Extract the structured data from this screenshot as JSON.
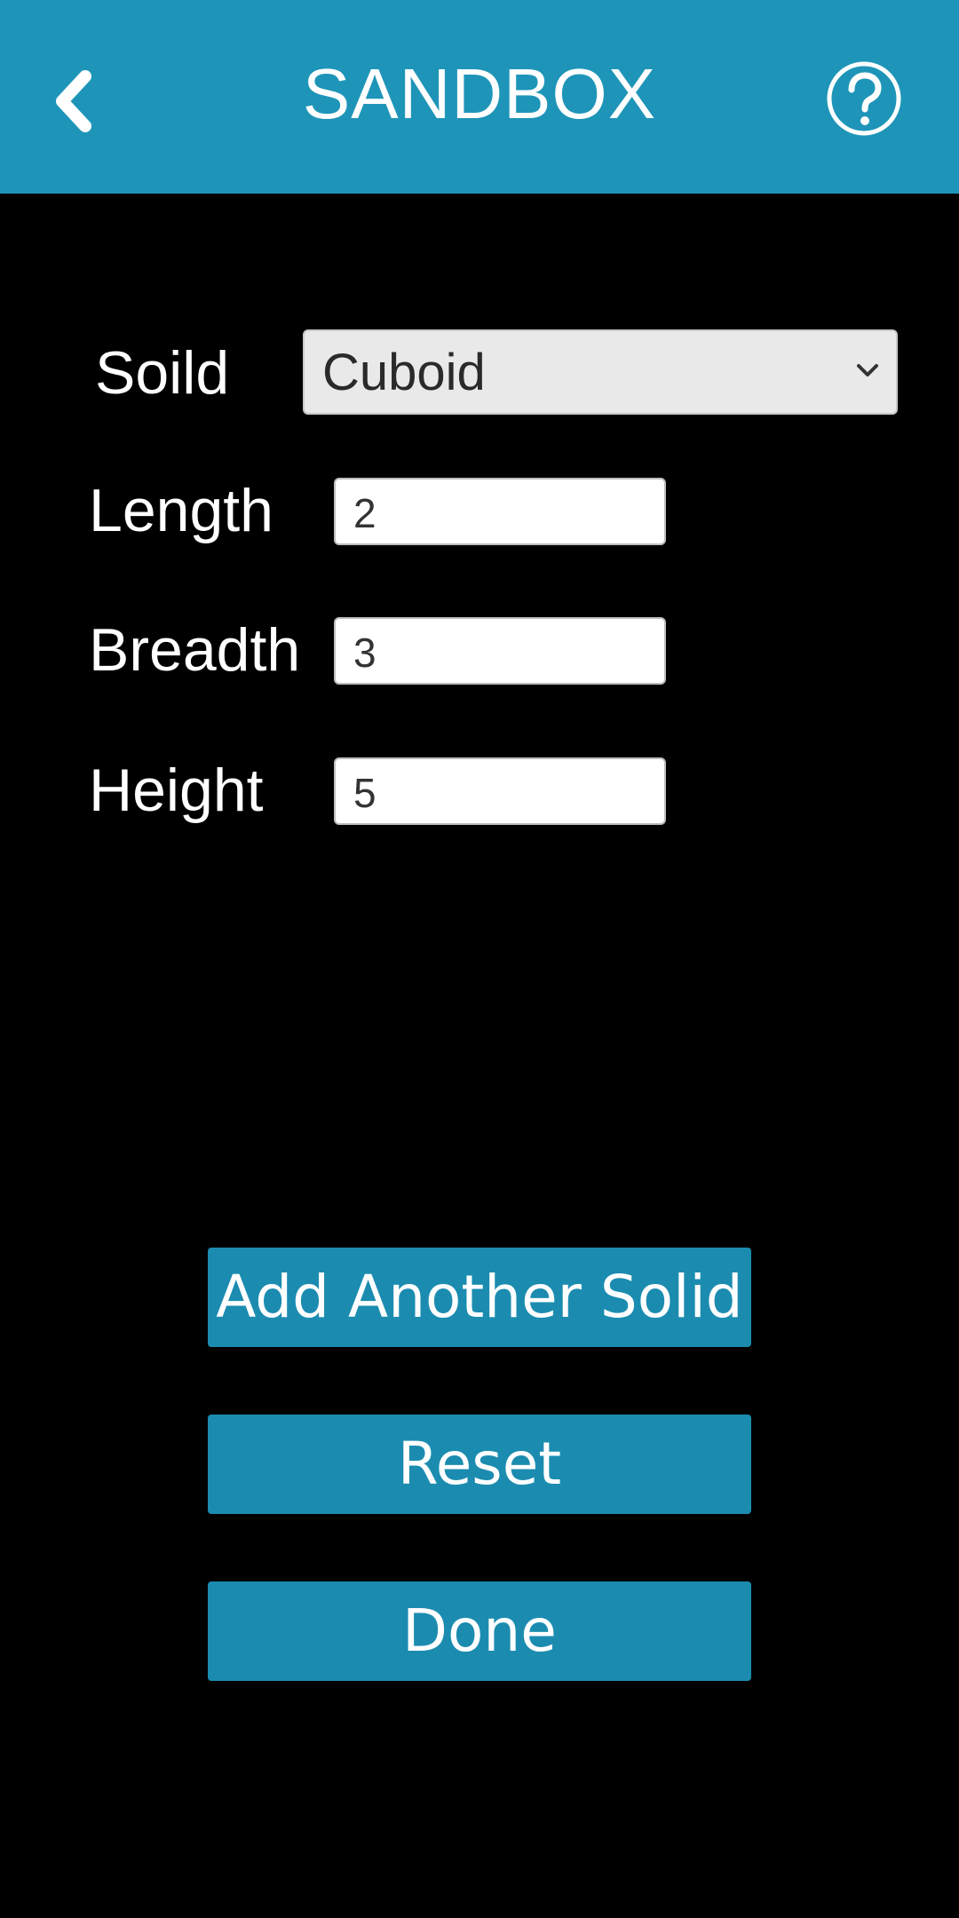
{
  "header": {
    "title": "SANDBOX",
    "back_icon": "chevron-left-icon",
    "help_icon": "help-circle-icon",
    "background_color": "#1e95b8"
  },
  "form": {
    "solid_label": "Soild",
    "solid_select": {
      "value": "Cuboid"
    },
    "length_label": "Length",
    "length_value": "2",
    "breadth_label": "Breadth",
    "breadth_value": "3",
    "height_label": "Height",
    "height_value": "5"
  },
  "actions": {
    "add_solid": "Add Another Solid",
    "reset": "Reset",
    "done": "Done",
    "button_color": "#1b8cb0"
  }
}
